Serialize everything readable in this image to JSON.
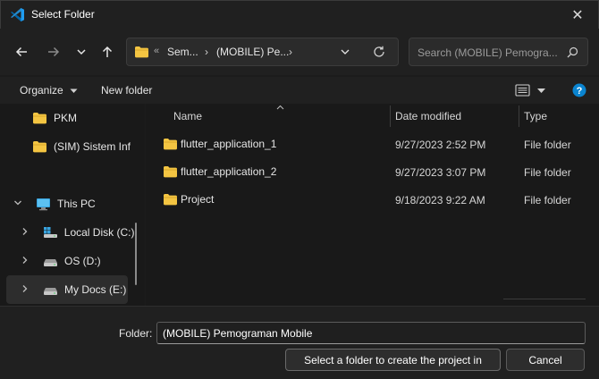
{
  "window": {
    "title": "Select Folder",
    "app_icon": "vscode-icon",
    "close_glyph": "✕"
  },
  "navigation": {
    "back": "arrow-left-icon",
    "forward": "arrow-right-icon",
    "recent": "chevron-down-icon",
    "up": "arrow-up-icon"
  },
  "address_bar": {
    "overflow_glyph": "«",
    "crumbs": [
      "Sem...",
      "(MOBILE) Pe..."
    ],
    "separator": "›"
  },
  "search": {
    "placeholder": "Search (MOBILE) Pemogra..."
  },
  "toolbar": {
    "organize_label": "Organize",
    "new_folder_label": "New folder"
  },
  "sidebar": {
    "items": [
      {
        "label": "PKM",
        "icon": "folder-icon",
        "expander": ""
      },
      {
        "label": "(SIM) Sistem Inf",
        "icon": "folder-icon",
        "expander": ""
      },
      {
        "label": "This PC",
        "icon": "monitor-icon",
        "expander": "⌄"
      },
      {
        "label": "Local Disk (C:)",
        "icon": "windows-drive-icon",
        "expander": "›"
      },
      {
        "label": "OS (D:)",
        "icon": "drive-icon",
        "expander": "›"
      },
      {
        "label": "My Docs (E:)",
        "icon": "drive-icon",
        "expander": "›"
      }
    ]
  },
  "file_list": {
    "columns": {
      "name": "Name",
      "date": "Date modified",
      "type": "Type"
    },
    "rows": [
      {
        "name": "flutter_application_1",
        "date": "9/27/2023 2:52 PM",
        "type": "File folder"
      },
      {
        "name": "flutter_application_2",
        "date": "9/27/2023 3:07 PM",
        "type": "File folder"
      },
      {
        "name": "Project",
        "date": "9/18/2023 9:22 AM",
        "type": "File folder"
      }
    ]
  },
  "footer": {
    "folder_label": "Folder:",
    "folder_value": "(MOBILE) Pemograman Mobile",
    "select_button": "Select a folder to create the project in",
    "cancel_button": "Cancel"
  },
  "colors": {
    "folder": "#f4c542",
    "accent": "#0a84d0"
  }
}
